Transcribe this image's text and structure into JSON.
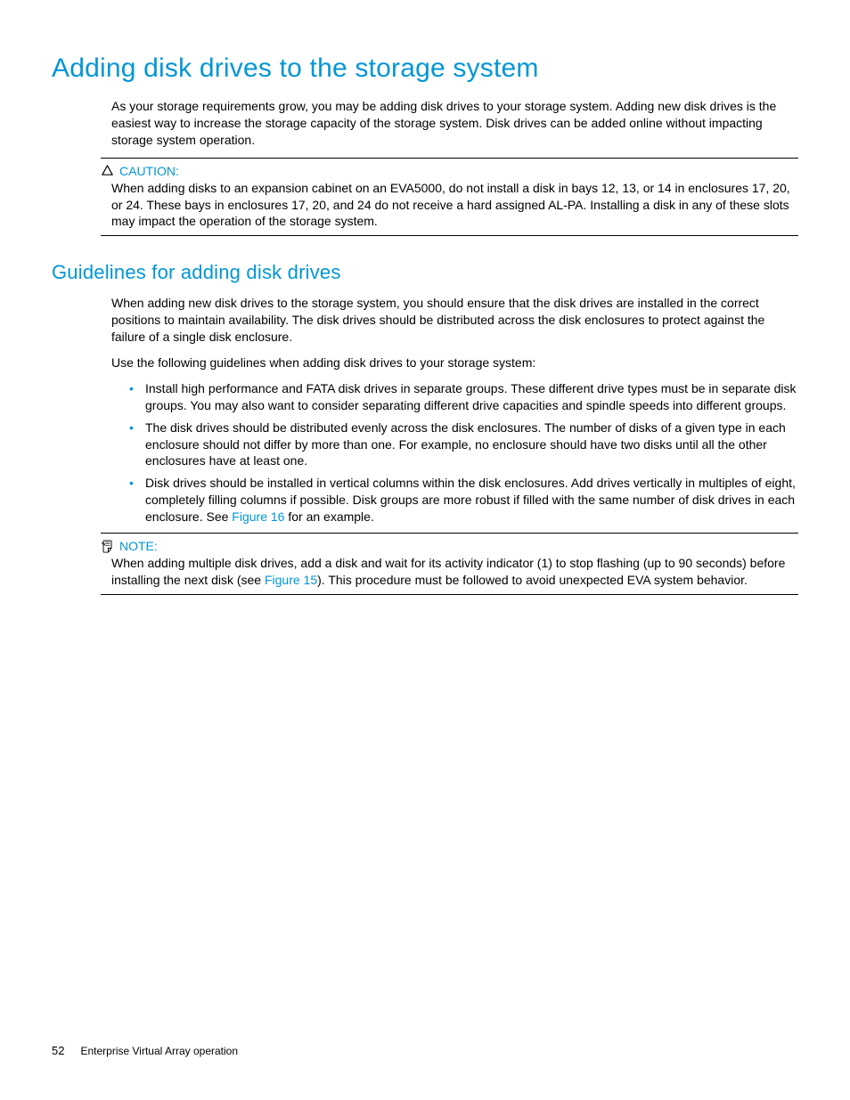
{
  "heading1": "Adding disk drives to the storage system",
  "intro": "As your storage requirements grow, you may be adding disk drives to your storage system. Adding new disk drives is the easiest way to increase the storage capacity of the storage system. Disk drives can be added online without impacting storage system operation.",
  "caution": {
    "label": "CAUTION:",
    "text": "When adding disks to an expansion cabinet on an EVA5000, do not install a disk in bays 12, 13, or 14 in enclosures 17, 20, or 24. These bays in enclosures 17, 20, and 24 do not receive a hard assigned AL-PA. Installing a disk in any of these slots may impact the operation of the storage system."
  },
  "heading2": "Guidelines for adding disk drives",
  "guidelines_intro": "When adding new disk drives to the storage system, you should ensure that the disk drives are installed in the correct positions to maintain availability. The disk drives should be distributed across the disk enclosures to protect against the failure of a single disk enclosure.",
  "guidelines_lead": "Use the following guidelines when adding disk drives to your storage system:",
  "bullets": [
    "Install high performance and FATA disk drives in separate groups. These different drive types must be in separate disk groups. You may also want to consider separating different drive capacities and spindle speeds into different groups.",
    "The disk drives should be distributed evenly across the disk enclosures. The number of disks of a given type in each enclosure should not differ by more than one. For example, no enclosure should have two disks until all the other enclosures have at least one."
  ],
  "bullet3_pre": "Disk drives should be installed in vertical columns within the disk enclosures. Add drives vertically in multiples of eight, completely filling columns if possible. Disk groups are more robust if filled with the same number of disk drives in each enclosure. See ",
  "bullet3_link": "Figure 16",
  "bullet3_post": " for an example.",
  "note": {
    "label": "NOTE:",
    "pre": "When adding multiple disk drives, add a disk and wait for its activity indicator (1) to stop flashing (up to 90 seconds) before installing the next disk (see ",
    "link": "Figure 15",
    "post": "). This procedure must be followed to avoid unexpected EVA system behavior."
  },
  "footer": {
    "page": "52",
    "title": "Enterprise Virtual Array operation"
  }
}
